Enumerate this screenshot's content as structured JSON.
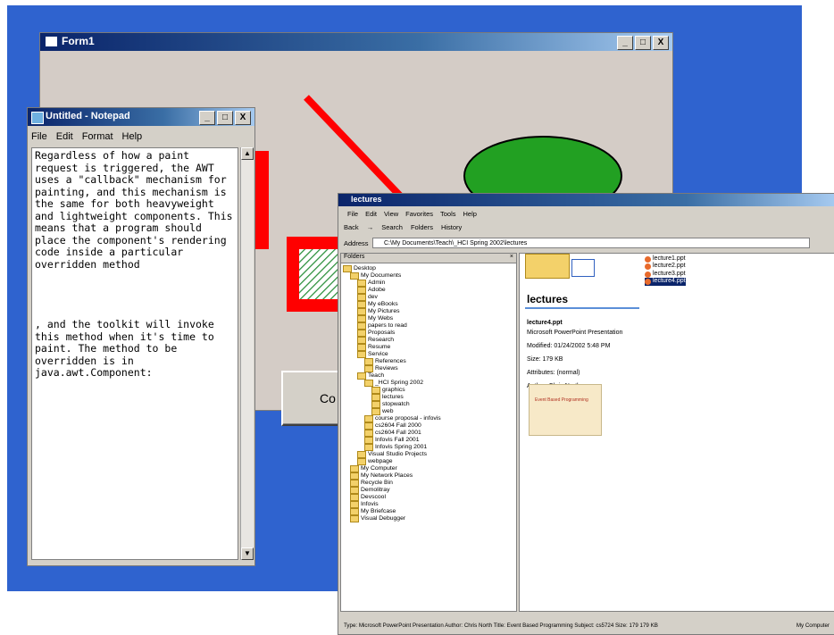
{
  "form1": {
    "title": "Form1",
    "controls": [
      "_",
      "□",
      "X"
    ],
    "command_button": "Co"
  },
  "notepad": {
    "title": "Untitled - Notepad",
    "controls": [
      "_",
      "□",
      "X"
    ],
    "menu": [
      "File",
      "Edit",
      "Format",
      "Help"
    ],
    "text": "Regardless of how a paint\nrequest is triggered, the AWT\nuses a \"callback\" mechanism for\npainting, and this mechanism is\nthe same for both heavyweight\nand lightweight components. This\nmeans that a program should\nplace the component's rendering\ncode inside a particular\noverridden method\n\n\n\n\n, and the toolkit will invoke\nthis method when it's time to\npaint. The method to be\noverridden is in\njava.awt.Component:"
  },
  "explorer": {
    "title": "lectures",
    "menu": [
      "File",
      "Edit",
      "View",
      "Favorites",
      "Tools",
      "Help"
    ],
    "toolbar": [
      "Back",
      "→",
      "Search",
      "Folders",
      "History"
    ],
    "address_label": "Address",
    "address_value": "C:\\My Documents\\Teach\\_HCI Spring 2002\\lectures",
    "folders_header": "Folders",
    "tree": [
      {
        "label": "Desktop",
        "depth": 0
      },
      {
        "label": "My Documents",
        "depth": 1
      },
      {
        "label": "Admin",
        "depth": 2
      },
      {
        "label": "Adobe",
        "depth": 2
      },
      {
        "label": "dev",
        "depth": 2
      },
      {
        "label": "My eBooks",
        "depth": 2
      },
      {
        "label": "My Pictures",
        "depth": 2
      },
      {
        "label": "My Webs",
        "depth": 2
      },
      {
        "label": "papers to read",
        "depth": 2
      },
      {
        "label": "Proposals",
        "depth": 2
      },
      {
        "label": "Research",
        "depth": 2
      },
      {
        "label": "Resume",
        "depth": 2
      },
      {
        "label": "Service",
        "depth": 2
      },
      {
        "label": "References",
        "depth": 3
      },
      {
        "label": "Reviews",
        "depth": 3
      },
      {
        "label": "Teach",
        "depth": 2
      },
      {
        "label": "_HCI Spring 2002",
        "depth": 3
      },
      {
        "label": "graphics",
        "depth": 4
      },
      {
        "label": "lectures",
        "depth": 4
      },
      {
        "label": "stopwatch",
        "depth": 4
      },
      {
        "label": "web",
        "depth": 4
      },
      {
        "label": "course proposal - infovis",
        "depth": 3
      },
      {
        "label": "cs2604 Fall 2000",
        "depth": 3
      },
      {
        "label": "cs2604 Fall 2001",
        "depth": 3
      },
      {
        "label": "Infovis Fall 2001",
        "depth": 3
      },
      {
        "label": "Infovis Spring 2001",
        "depth": 3
      },
      {
        "label": "Visual Studio Projects",
        "depth": 2
      },
      {
        "label": "webpage",
        "depth": 2
      },
      {
        "label": "My Computer",
        "depth": 1
      },
      {
        "label": "My Network Places",
        "depth": 1
      },
      {
        "label": "Recycle Bin",
        "depth": 1
      },
      {
        "label": "Demolitray",
        "depth": 1
      },
      {
        "label": "Devscool",
        "depth": 1
      },
      {
        "label": "Infovis",
        "depth": 1
      },
      {
        "label": "My Briefcase",
        "depth": 1
      },
      {
        "label": "Visual Debugger",
        "depth": 1
      }
    ],
    "folder_heading": "lectures",
    "details": [
      "lecture4.ppt",
      "Microsoft PowerPoint Presentation",
      "",
      "Modified: 01/24/2002 5:48 PM",
      "",
      "Size: 179 KB",
      "",
      "Attributes: (normal)",
      "",
      "Author: Chris North"
    ],
    "thumbnail_text": "Event Based Programming",
    "files": [
      {
        "name": "lecture1.ppt",
        "selected": false
      },
      {
        "name": "lecture2.ppt",
        "selected": false
      },
      {
        "name": "lecture3.ppt",
        "selected": false
      },
      {
        "name": "lecture4.ppt",
        "selected": true
      }
    ],
    "status_left": "Type: Microsoft PowerPoint Presentation Author: Chris North Title: Event Based Programming Subject: cs5724 Size: 179 179 KB",
    "status_right": "My Computer"
  }
}
